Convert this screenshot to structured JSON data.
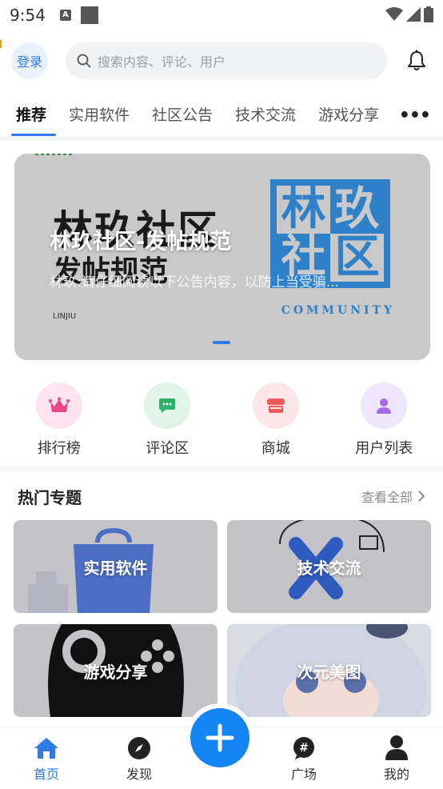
{
  "status_bar": {
    "time": "9:54"
  },
  "header": {
    "login_label": "登录",
    "search_placeholder": "搜索内容、评论、用户"
  },
  "tabs": [
    {
      "label": "推荐",
      "active": true
    },
    {
      "label": "实用软件"
    },
    {
      "label": "社区公告"
    },
    {
      "label": "技术交流"
    },
    {
      "label": "游戏分享"
    }
  ],
  "banner": {
    "image_text_line1": "林玖社区",
    "image_text_line2": "发帖规范",
    "image_small": "LINJIU",
    "stamp_chars": [
      "林",
      "玖",
      "社",
      "区"
    ],
    "stamp_sub": "COMMUNITY",
    "title": "林玖社区-发帖规范",
    "description": "林玖:请仔细阅读以下公告内容，以防上当受骗..."
  },
  "shortcuts": [
    {
      "label": "排行榜",
      "icon": "crown-icon",
      "bg": "#fde4ee",
      "color": "#e8478b"
    },
    {
      "label": "评论区",
      "icon": "chat-bubble-icon",
      "bg": "#e1f4ea",
      "color": "#2fb36a"
    },
    {
      "label": "商城",
      "icon": "store-icon",
      "bg": "#fde6e6",
      "color": "#ef5b5b"
    },
    {
      "label": "用户列表",
      "icon": "user-icon",
      "bg": "#efe6fb",
      "color": "#a26ae6"
    }
  ],
  "hot_topics": {
    "title": "热门专题",
    "see_all": "查看全部",
    "cards": [
      {
        "label": "实用软件"
      },
      {
        "label": "技术交流"
      },
      {
        "label": "游戏分享"
      },
      {
        "label": "次元美图"
      }
    ]
  },
  "bottom_nav": [
    {
      "label": "首页",
      "icon": "home-icon",
      "active": true
    },
    {
      "label": "发现",
      "icon": "compass-icon"
    },
    {
      "label": "广场",
      "icon": "hash-bubble-icon"
    },
    {
      "label": "我的",
      "icon": "person-icon"
    }
  ],
  "colors": {
    "accent": "#2e7be6",
    "fab": "#1584f5"
  }
}
